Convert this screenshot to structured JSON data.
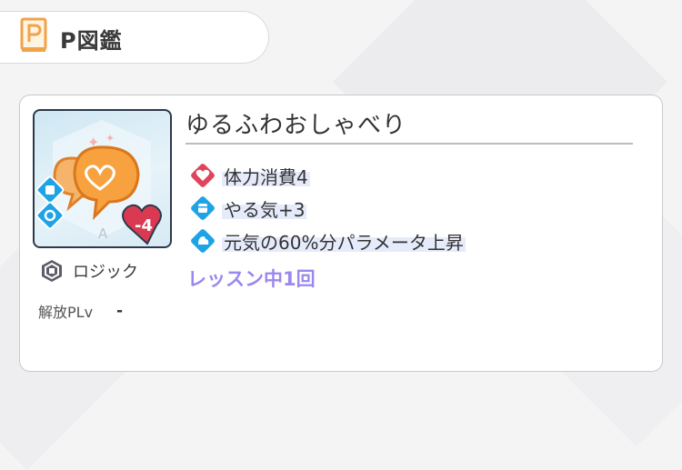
{
  "header": {
    "title": "P図鑑",
    "icon": "book-p-icon"
  },
  "card": {
    "title": "ゆるふわおしゃべり",
    "type_label": "ロジック",
    "unlock": {
      "label": "解放PLv",
      "value": "-"
    },
    "cost_badge": "-4",
    "grade_letter": "A",
    "effects": [
      {
        "icon": "heart-diamond-icon",
        "text": "体力消費4"
      },
      {
        "icon": "fist-diamond-icon",
        "text": "やる気+3"
      },
      {
        "icon": "flex-arm-diamond-icon",
        "text": "元気の60%分パラメータ上昇"
      }
    ],
    "lesson_limit": "レッスン中1回"
  },
  "colors": {
    "accent_orange": "#f0a34a",
    "heart_red": "#e0445a",
    "blue_diamond": "#1ea3e6",
    "lesson_purple": "#9b87f0"
  }
}
